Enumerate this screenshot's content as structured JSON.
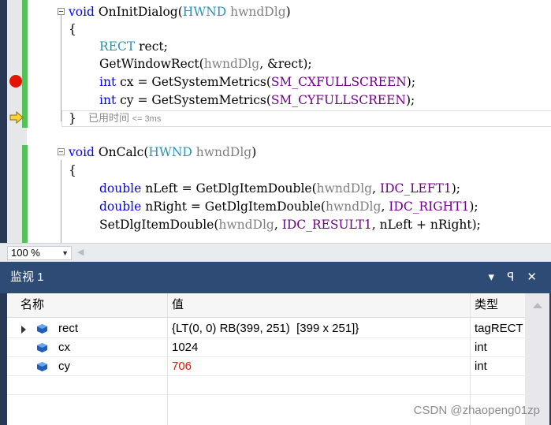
{
  "editor": {
    "lines": [
      {
        "parts": [
          {
            "t": "void",
            "c": "kw"
          },
          {
            "t": " OnInitDialog("
          },
          {
            "t": "HWND",
            "c": "ty"
          },
          {
            "t": " "
          },
          {
            "t": "hwndDlg",
            "c": "par"
          },
          {
            "t": ")"
          }
        ]
      },
      {
        "parts": [
          {
            "t": "{"
          }
        ]
      },
      {
        "parts": [
          {
            "t": "RECT",
            "c": "ty"
          },
          {
            "t": " rect;"
          }
        ]
      },
      {
        "parts": [
          {
            "t": "GetWindowRect("
          },
          {
            "t": "hwndDlg",
            "c": "par"
          },
          {
            "t": ", &rect);"
          }
        ]
      },
      {
        "parts": [
          {
            "t": "int",
            "c": "kw"
          },
          {
            "t": " cx = GetSystemMetrics("
          },
          {
            "t": "SM_CXFULLSCREEN",
            "c": "mac"
          },
          {
            "t": ");"
          }
        ]
      },
      {
        "parts": [
          {
            "t": "int",
            "c": "kw"
          },
          {
            "t": " cy = GetSystemMetrics("
          },
          {
            "t": "SM_CYFULLSCREEN",
            "c": "mac"
          },
          {
            "t": ");"
          }
        ]
      },
      {
        "parts": [
          {
            "t": "}"
          }
        ]
      },
      {
        "parts": [
          {
            "t": "void",
            "c": "kw"
          },
          {
            "t": " OnCalc("
          },
          {
            "t": "HWND",
            "c": "ty"
          },
          {
            "t": " "
          },
          {
            "t": "hwndDlg",
            "c": "par"
          },
          {
            "t": ")"
          }
        ]
      },
      {
        "parts": [
          {
            "t": "{"
          }
        ]
      },
      {
        "parts": [
          {
            "t": "double",
            "c": "kw"
          },
          {
            "t": " nLeft = GetDlgItemDouble("
          },
          {
            "t": "hwndDlg",
            "c": "par"
          },
          {
            "t": ", "
          },
          {
            "t": "IDC_LEFT1",
            "c": "mac"
          },
          {
            "t": ");"
          }
        ]
      },
      {
        "parts": [
          {
            "t": "double",
            "c": "kw"
          },
          {
            "t": " nRight = GetDlgItemDouble("
          },
          {
            "t": "hwndDlg",
            "c": "par"
          },
          {
            "t": ", "
          },
          {
            "t": "IDC_RIGHT1",
            "c": "mac"
          },
          {
            "t": ");"
          }
        ]
      },
      {
        "parts": [
          {
            "t": "SetDlgItemDouble("
          },
          {
            "t": "hwndDlg",
            "c": "par"
          },
          {
            "t": ", "
          },
          {
            "t": "IDC_RESULT1",
            "c": "mac"
          },
          {
            "t": ", nLeft + nRight);"
          }
        ]
      }
    ],
    "perf_tip": {
      "label": "已用时间",
      "value": "<= 3ms"
    },
    "colors": {
      "keyword": "#0000ff",
      "type": "#2b91af",
      "macro": "#6f008a",
      "param": "#808080",
      "breakpoint": "#e51400",
      "change_bar": "#56c15a"
    }
  },
  "zoom": {
    "value": "100 %"
  },
  "watch": {
    "title": "监视 1",
    "header_icons": [
      "dropdown-icon",
      "pin-icon",
      "close-icon"
    ],
    "columns": [
      "名称",
      "值",
      "类型"
    ],
    "rows": [
      {
        "name": "rect",
        "value": "{LT(0, 0) RB(399, 251)  [399 x 251]}",
        "type": "tagRECT",
        "expandable": true,
        "changed": false
      },
      {
        "name": "cx",
        "value": "1024",
        "type": "int",
        "expandable": false,
        "changed": false
      },
      {
        "name": "cy",
        "value": "706",
        "type": "int",
        "expandable": false,
        "changed": true
      }
    ]
  },
  "watermark": "CSDN @zhaopeng01zp"
}
